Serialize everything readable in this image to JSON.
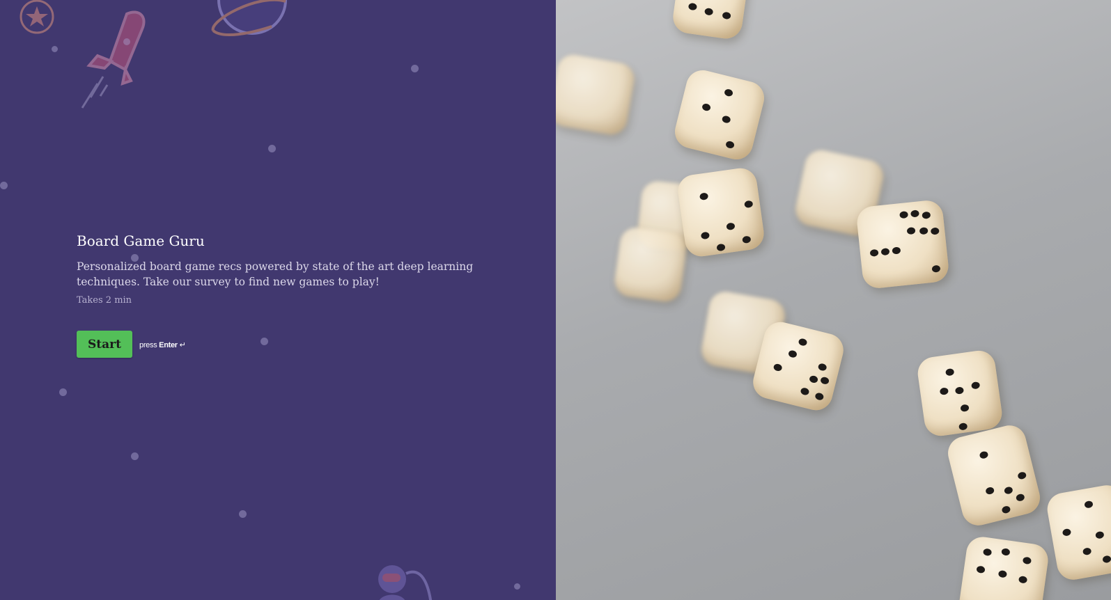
{
  "theme": {
    "background": "#41386f",
    "accent": "#53bf58",
    "photo_tone": "#a9abae"
  },
  "app": {
    "title": "Board Game Guru",
    "description": "Personalized board game recs powered by state of the art deep learning techniques. Take our survey to find new games to play!",
    "duration": "Takes 2 min"
  },
  "actions": {
    "start_label": "Start",
    "hint_prefix": "press",
    "hint_key": "Enter",
    "hint_icon": "↵"
  },
  "decorations": [
    "star-badge-icon",
    "rocket-icon",
    "planet-icon",
    "astronaut-icon"
  ],
  "hero_image": {
    "subject": "dice-photo"
  }
}
